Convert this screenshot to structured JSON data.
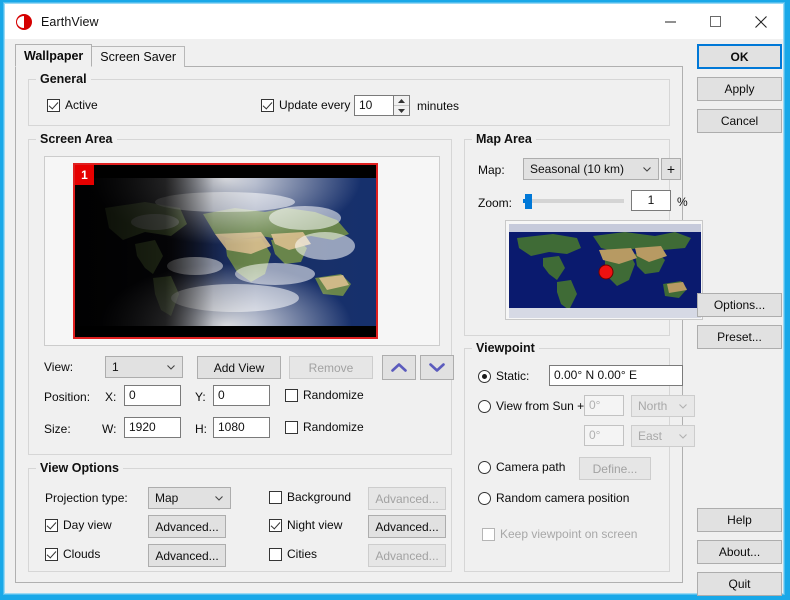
{
  "window": {
    "title": "EarthView",
    "icon": "earth-globe-icon",
    "controls": {
      "minimize": "minimize-icon",
      "maximize": "maximize-icon",
      "close": "close-icon"
    },
    "border_color": "#19a8e8"
  },
  "tabs": [
    {
      "label": "Wallpaper",
      "active": true
    },
    {
      "label": "Screen Saver",
      "active": false
    }
  ],
  "general": {
    "title": "General",
    "active": {
      "label": "Active",
      "checked": true
    },
    "update_every": {
      "label": "Update every",
      "checked": true
    },
    "interval_value": "10",
    "unit_label": "minutes"
  },
  "screen_area": {
    "title": "Screen Area",
    "monitor_badge": "1",
    "view_label": "View:",
    "view_value": "1",
    "add_view_button": "Add View",
    "remove_button": "Remove",
    "move_up_icon": "chevron-up-icon",
    "move_down_icon": "chevron-down-icon",
    "position_label": "Position:",
    "x_label": "X:",
    "x_value": "0",
    "y_label": "Y:",
    "y_value": "0",
    "position_randomize": {
      "label": "Randomize",
      "checked": false
    },
    "size_label": "Size:",
    "w_label": "W:",
    "w_value": "1920",
    "h_label": "H:",
    "h_value": "1080",
    "size_randomize": {
      "label": "Randomize",
      "checked": false
    }
  },
  "view_options": {
    "title": "View Options",
    "projection_label": "Projection type:",
    "projection_value": "Map",
    "day_view": {
      "label": "Day view",
      "checked": true,
      "button": "Advanced...",
      "enabled": true
    },
    "clouds": {
      "label": "Clouds",
      "checked": true,
      "button": "Advanced...",
      "enabled": true
    },
    "background": {
      "label": "Background",
      "checked": false,
      "button": "Advanced...",
      "enabled": false
    },
    "night_view": {
      "label": "Night view",
      "checked": true,
      "button": "Advanced...",
      "enabled": true
    },
    "cities": {
      "label": "Cities",
      "checked": false,
      "button": "Advanced...",
      "enabled": false
    }
  },
  "map_area": {
    "title": "Map Area",
    "map_label": "Map:",
    "map_value": "Seasonal (10 km)",
    "add_map_button": "+",
    "zoom_label": "Zoom:",
    "zoom_value": "1",
    "zoom_unit": "%",
    "zoom_percent_fill": 4
  },
  "viewpoint": {
    "title": "Viewpoint",
    "static": {
      "label": "Static:",
      "selected": true,
      "value": "0.00° N   0.00° E"
    },
    "view_from_sun": {
      "label": "View from Sun +",
      "selected": false,
      "angle1": "0°",
      "dir1": "North",
      "angle2": "0°",
      "dir2": "East"
    },
    "camera_path": {
      "label": "Camera path",
      "selected": false,
      "button": "Define...",
      "enabled": false
    },
    "random_camera": {
      "label": "Random camera position",
      "selected": false
    },
    "keep_viewpoint": {
      "label": "Keep viewpoint on screen",
      "checked": false,
      "enabled": false
    }
  },
  "side_buttons": {
    "ok": "OK",
    "apply": "Apply",
    "cancel": "Cancel",
    "options": "Options...",
    "preset": "Preset...",
    "help": "Help",
    "about": "About...",
    "quit": "Quit"
  }
}
